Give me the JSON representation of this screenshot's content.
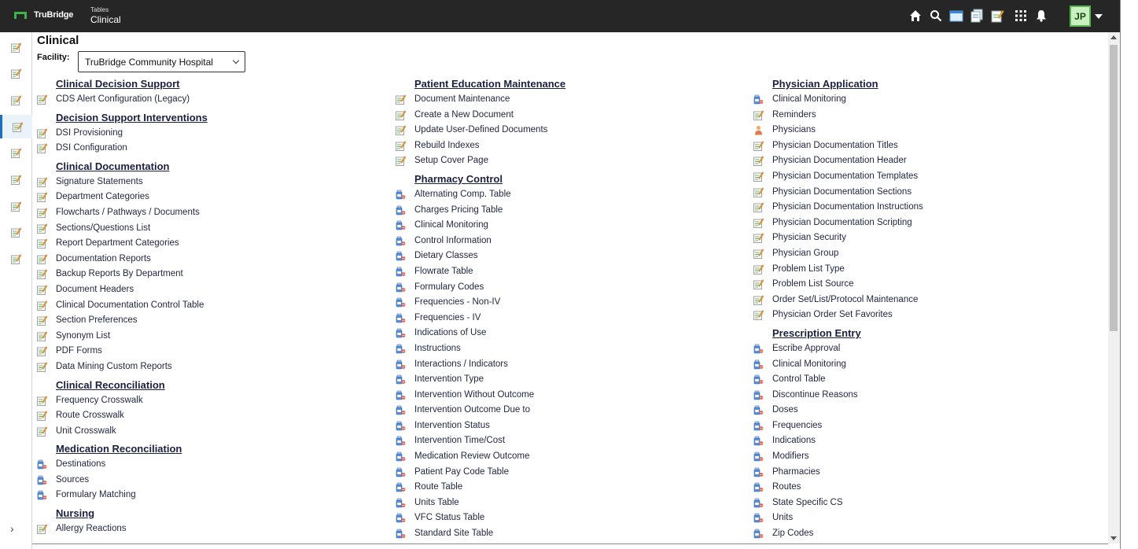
{
  "app": {
    "brand": "TruBridge",
    "breadcrumb_parent": "Tables",
    "breadcrumb_current": "Clinical",
    "user_initials": "JP",
    "top_icons": [
      "home-icon",
      "search-icon",
      "window-icon",
      "documents-icon",
      "edit-note-icon",
      "apps-grid-icon",
      "bell-icon"
    ]
  },
  "page": {
    "title": "Clinical",
    "facility_label": "Facility:",
    "facility_value": "TruBridge Community Hospital"
  },
  "colors": {
    "topbar": "#262626",
    "accent_green": "#39b54a",
    "link": "#1f2440"
  },
  "columns": [
    [
      {
        "title": "Clinical Decision Support",
        "items": [
          {
            "label": "CDS Alert Configuration (Legacy)",
            "icon": "edit"
          }
        ]
      },
      {
        "title": "Decision Support Interventions",
        "items": [
          {
            "label": "DSI Provisioning",
            "icon": "edit"
          },
          {
            "label": "DSI Configuration",
            "icon": "edit"
          }
        ]
      },
      {
        "title": "Clinical Documentation",
        "items": [
          {
            "label": "Signature Statements",
            "icon": "edit"
          },
          {
            "label": "Department Categories",
            "icon": "edit"
          },
          {
            "label": "Flowcharts / Pathways / Documents",
            "icon": "edit"
          },
          {
            "label": "Sections/Questions List",
            "icon": "edit"
          },
          {
            "label": "Report Department Categories",
            "icon": "edit"
          },
          {
            "label": "Documentation Reports",
            "icon": "edit"
          },
          {
            "label": "Backup Reports By Department",
            "icon": "edit"
          },
          {
            "label": "Document Headers",
            "icon": "edit"
          },
          {
            "label": "Clinical Documentation Control Table",
            "icon": "edit"
          },
          {
            "label": "Section Preferences",
            "icon": "edit"
          },
          {
            "label": "Synonym List",
            "icon": "edit"
          },
          {
            "label": "PDF Forms",
            "icon": "edit"
          },
          {
            "label": "Data Mining Custom Reports",
            "icon": "edit"
          }
        ]
      },
      {
        "title": "Clinical Reconciliation",
        "items": [
          {
            "label": "Frequency Crosswalk",
            "icon": "edit"
          },
          {
            "label": "Route Crosswalk",
            "icon": "edit"
          },
          {
            "label": "Unit Crosswalk",
            "icon": "edit"
          }
        ]
      },
      {
        "title": "Medication Reconciliation",
        "items": [
          {
            "label": "Destinations",
            "icon": "bottle"
          },
          {
            "label": "Sources",
            "icon": "bottle"
          },
          {
            "label": "Formulary Matching",
            "icon": "bottle"
          }
        ]
      },
      {
        "title": "Nursing",
        "items": [
          {
            "label": "Allergy Reactions",
            "icon": "edit"
          }
        ]
      }
    ],
    [
      {
        "title": "Patient Education Maintenance",
        "items": [
          {
            "label": "Document Maintenance",
            "icon": "edit"
          },
          {
            "label": "Create a New Document",
            "icon": "edit"
          },
          {
            "label": "Update User-Defined Documents",
            "icon": "edit"
          },
          {
            "label": "Rebuild Indexes",
            "icon": "edit"
          },
          {
            "label": "Setup Cover Page",
            "icon": "edit"
          }
        ]
      },
      {
        "title": "Pharmacy Control",
        "items": [
          {
            "label": "Alternating Comp. Table",
            "icon": "bottle"
          },
          {
            "label": "Charges Pricing Table",
            "icon": "bottle"
          },
          {
            "label": "Clinical Monitoring",
            "icon": "bottle"
          },
          {
            "label": "Control Information",
            "icon": "bottle"
          },
          {
            "label": "Dietary Classes",
            "icon": "bottle"
          },
          {
            "label": "Flowrate Table",
            "icon": "bottle"
          },
          {
            "label": "Formulary Codes",
            "icon": "bottle"
          },
          {
            "label": "Frequencies - Non-IV",
            "icon": "bottle"
          },
          {
            "label": "Frequencies - IV",
            "icon": "bottle"
          },
          {
            "label": "Indications of Use",
            "icon": "bottle"
          },
          {
            "label": "Instructions",
            "icon": "bottle"
          },
          {
            "label": "Interactions / Indicators",
            "icon": "bottle"
          },
          {
            "label": "Intervention Type",
            "icon": "bottle"
          },
          {
            "label": "Intervention Without Outcome",
            "icon": "bottle"
          },
          {
            "label": "Intervention Outcome Due to",
            "icon": "bottle"
          },
          {
            "label": "Intervention Status",
            "icon": "bottle"
          },
          {
            "label": "Intervention Time/Cost",
            "icon": "bottle"
          },
          {
            "label": "Medication Review Outcome",
            "icon": "bottle"
          },
          {
            "label": "Patient Pay Code Table",
            "icon": "bottle"
          },
          {
            "label": "Route Table",
            "icon": "bottle"
          },
          {
            "label": "Units Table",
            "icon": "bottle"
          },
          {
            "label": "VFC Status Table",
            "icon": "bottle"
          },
          {
            "label": "Standard Site Table",
            "icon": "bottle"
          }
        ]
      }
    ],
    [
      {
        "title": "Physician Application",
        "items": [
          {
            "label": "Clinical Monitoring",
            "icon": "bottle"
          },
          {
            "label": "Reminders",
            "icon": "edit"
          },
          {
            "label": "Physicians",
            "icon": "person"
          },
          {
            "label": "Physician Documentation Titles",
            "icon": "edit"
          },
          {
            "label": "Physician Documentation Header",
            "icon": "edit"
          },
          {
            "label": "Physician Documentation Templates",
            "icon": "edit"
          },
          {
            "label": "Physician Documentation Sections",
            "icon": "edit"
          },
          {
            "label": "Physician Documentation Instructions",
            "icon": "edit"
          },
          {
            "label": "Physician Documentation Scripting",
            "icon": "edit"
          },
          {
            "label": "Physician Security",
            "icon": "edit"
          },
          {
            "label": "Physician Group",
            "icon": "edit"
          },
          {
            "label": "Problem List Type",
            "icon": "edit"
          },
          {
            "label": "Problem List Source",
            "icon": "edit"
          },
          {
            "label": "Order Set/List/Protocol Maintenance",
            "icon": "edit"
          },
          {
            "label": "Physician Order Set Favorites",
            "icon": "edit"
          }
        ]
      },
      {
        "title": "Prescription Entry",
        "items": [
          {
            "label": "Escribe Approval",
            "icon": "bottle"
          },
          {
            "label": "Clinical Monitoring",
            "icon": "bottle"
          },
          {
            "label": "Control Table",
            "icon": "bottle"
          },
          {
            "label": "Discontinue Reasons",
            "icon": "bottle"
          },
          {
            "label": "Doses",
            "icon": "bottle"
          },
          {
            "label": "Frequencies",
            "icon": "bottle"
          },
          {
            "label": "Indications",
            "icon": "bottle"
          },
          {
            "label": "Modifiers",
            "icon": "bottle"
          },
          {
            "label": "Pharmacies",
            "icon": "bottle"
          },
          {
            "label": "Routes",
            "icon": "bottle"
          },
          {
            "label": "State Specific CS",
            "icon": "bottle"
          },
          {
            "label": "Units",
            "icon": "bottle"
          },
          {
            "label": "Zip Codes",
            "icon": "bottle"
          }
        ]
      }
    ]
  ],
  "rail": {
    "items": 9,
    "active_index": 3
  }
}
